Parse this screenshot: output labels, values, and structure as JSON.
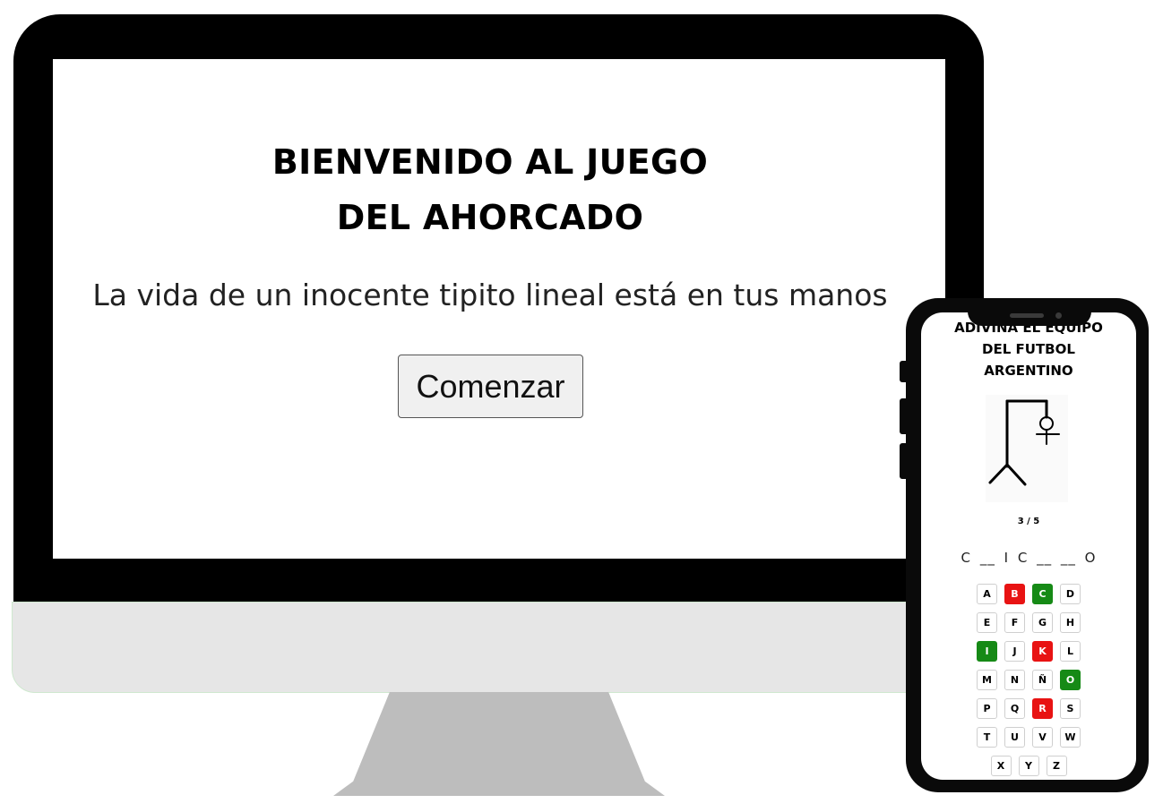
{
  "desktop": {
    "title_line1": "BIENVENIDO AL JUEGO",
    "title_line2": "DEL AHORCADO",
    "tagline": "La vida de un inocente tipito lineal está en tus manos",
    "start_button": "Comenzar"
  },
  "mobile": {
    "title_line1": "ADIVINA EL EQUIPO",
    "title_line2": "DEL FUTBOL",
    "title_line3": "ARGENTINO",
    "attempts": "3 / 5",
    "word": [
      "C",
      "__",
      "I",
      "C",
      "__",
      "__",
      "O"
    ],
    "keyboard_rows": [
      [
        {
          "letter": "A",
          "state": "unused"
        },
        {
          "letter": "B",
          "state": "wrong"
        },
        {
          "letter": "C",
          "state": "correct"
        },
        {
          "letter": "D",
          "state": "unused"
        }
      ],
      [
        {
          "letter": "E",
          "state": "unused"
        },
        {
          "letter": "F",
          "state": "unused"
        },
        {
          "letter": "G",
          "state": "unused"
        },
        {
          "letter": "H",
          "state": "unused"
        }
      ],
      [
        {
          "letter": "I",
          "state": "correct"
        },
        {
          "letter": "J",
          "state": "unused"
        },
        {
          "letter": "K",
          "state": "wrong"
        },
        {
          "letter": "L",
          "state": "unused"
        }
      ],
      [
        {
          "letter": "M",
          "state": "unused"
        },
        {
          "letter": "N",
          "state": "unused"
        },
        {
          "letter": "Ñ",
          "state": "unused"
        },
        {
          "letter": "O",
          "state": "correct"
        }
      ],
      [
        {
          "letter": "P",
          "state": "unused"
        },
        {
          "letter": "Q",
          "state": "unused"
        },
        {
          "letter": "R",
          "state": "wrong"
        },
        {
          "letter": "S",
          "state": "unused"
        }
      ],
      [
        {
          "letter": "T",
          "state": "unused"
        },
        {
          "letter": "U",
          "state": "unused"
        },
        {
          "letter": "V",
          "state": "unused"
        },
        {
          "letter": "W",
          "state": "unused"
        }
      ],
      [
        {
          "letter": "X",
          "state": "unused"
        },
        {
          "letter": "Y",
          "state": "unused"
        },
        {
          "letter": "Z",
          "state": "unused"
        }
      ]
    ]
  },
  "colors": {
    "wrong": "#e81313",
    "correct": "#168a16",
    "monitor_frame": "#000000",
    "monitor_chin": "#e6e6e6",
    "monitor_stand": "#bdbdbd"
  }
}
